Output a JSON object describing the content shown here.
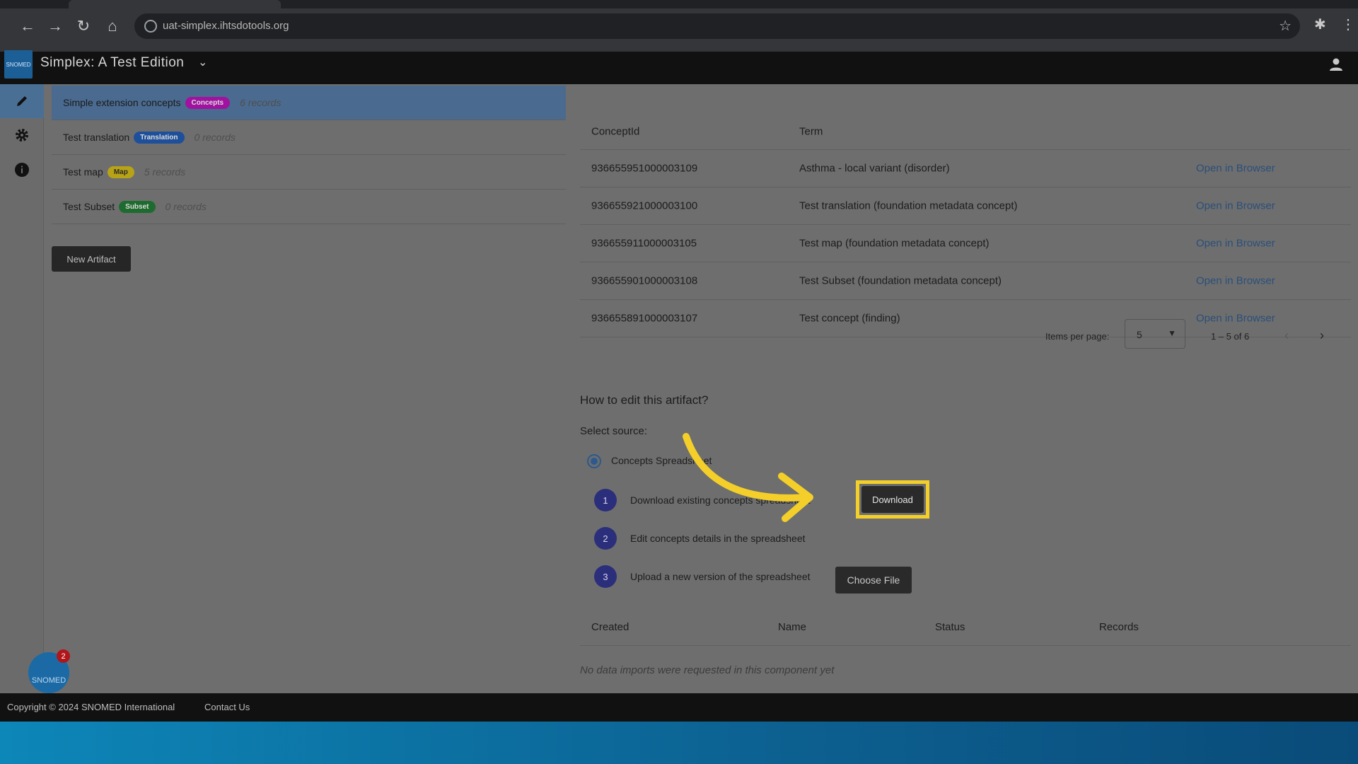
{
  "browser": {
    "url": "uat-simplex.ihtsdotools.org"
  },
  "app": {
    "title": "Simplex: A Test Edition",
    "logo_text": "SNOMED"
  },
  "artifacts": [
    {
      "name": "Simple extension concepts",
      "badge": "Concepts",
      "badge_color": "#a0129f",
      "records": "6 records",
      "selected": true
    },
    {
      "name": "Test translation",
      "badge": "Translation",
      "badge_color": "#1e4f9a",
      "records": "0 records",
      "selected": false
    },
    {
      "name": "Test map",
      "badge": "Map",
      "badge_color": "#b8a316",
      "records": "5 records",
      "selected": false
    },
    {
      "name": "Test Subset",
      "badge": "Subset",
      "badge_color": "#1d6b2e",
      "records": "0 records",
      "selected": false
    }
  ],
  "new_artifact_label": "New Artifact",
  "concepts_table": {
    "headers": {
      "id": "ConceptId",
      "term": "Term"
    },
    "rows": [
      {
        "id": "936655951000003109",
        "term": "Asthma - local variant (disorder)",
        "link": "Open in Browser"
      },
      {
        "id": "936655921000003100",
        "term": "Test translation (foundation metadata concept)",
        "link": "Open in Browser"
      },
      {
        "id": "936655911000003105",
        "term": "Test map (foundation metadata concept)",
        "link": "Open in Browser"
      },
      {
        "id": "936655901000003108",
        "term": "Test Subset (foundation metadata concept)",
        "link": "Open in Browser"
      },
      {
        "id": "936655891000003107",
        "term": "Test concept (finding)",
        "link": "Open in Browser"
      }
    ]
  },
  "paginator": {
    "label": "Items per page:",
    "page_size": "5",
    "range": "1 – 5 of 6"
  },
  "edit_section": {
    "title": "How to edit this artifact?",
    "select_source": "Select source:",
    "source_option": "Concepts Spreadsheet",
    "steps": [
      {
        "num": "1",
        "text": "Download existing concepts spreadsheet"
      },
      {
        "num": "2",
        "text": "Edit concepts details in the spreadsheet"
      },
      {
        "num": "3",
        "text": "Upload a new version of the spreadsheet"
      }
    ],
    "download_label": "Download",
    "choose_file_label": "Choose File"
  },
  "imports_table": {
    "headers": {
      "created": "Created",
      "name": "Name",
      "status": "Status",
      "records": "Records"
    },
    "empty": "No data imports were requested in this component yet"
  },
  "fab": {
    "label": "SNOMED",
    "count": "2"
  },
  "footer": {
    "copyright": "Copyright © 2024 SNOMED International",
    "contact": "Contact Us"
  },
  "colors": {
    "highlight": "#f4cf2a",
    "accent": "#2c5a8c"
  }
}
